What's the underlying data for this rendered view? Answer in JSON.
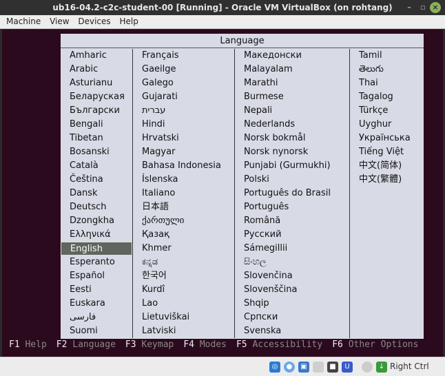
{
  "window": {
    "title": "ub16-04.2-c2c-student-00 [Running] - Oracle VM VirtualBox (on rohtang)"
  },
  "menu": [
    "Machine",
    "View",
    "Devices",
    "Help"
  ],
  "dialog": {
    "title": "Language",
    "selected": "English",
    "columns": [
      [
        "Amharic",
        "Arabic",
        "Asturianu",
        "Беларуская",
        "Български",
        "Bengali",
        "Tibetan",
        "Bosanski",
        "Català",
        "Čeština",
        "Dansk",
        "Deutsch",
        "Dzongkha",
        "Ελληνικά",
        "English",
        "Esperanto",
        "Español",
        "Eesti",
        "Euskara",
        "فارسی",
        "Suomi"
      ],
      [
        "Français",
        "Gaeilge",
        "Galego",
        "Gujarati",
        "עברית",
        "Hindi",
        "Hrvatski",
        "Magyar",
        "Bahasa Indonesia",
        "Íslenska",
        "Italiano",
        "日本語",
        "ქართული",
        "Қазақ",
        "Khmer",
        "ಕನ್ನಡ",
        "한국어",
        "Kurdî",
        "Lao",
        "Lietuviškai",
        "Latviski"
      ],
      [
        "Македонски",
        "Malayalam",
        "Marathi",
        "Burmese",
        "Nepali",
        "Nederlands",
        "Norsk bokmål",
        "Norsk nynorsk",
        "Punjabi (Gurmukhi)",
        "Polski",
        "Português do Brasil",
        "Português",
        "Română",
        "Русский",
        "Sámegillii",
        "සිංහල",
        "Slovenčina",
        "Slovenščina",
        "Shqip",
        "Српски",
        "Svenska"
      ],
      [
        "Tamil",
        "తెలుగు",
        "Thai",
        "Tagalog",
        "Türkçe",
        "Uyghur",
        "Українська",
        "Tiếng Việt",
        "中文(简体)",
        "中文(繁體)"
      ]
    ]
  },
  "fkeys": [
    {
      "key": "F1",
      "label": "Help"
    },
    {
      "key": "F2",
      "label": "Language"
    },
    {
      "key": "F3",
      "label": "Keymap"
    },
    {
      "key": "F4",
      "label": "Modes"
    },
    {
      "key": "F5",
      "label": "Accessibility"
    },
    {
      "key": "F6",
      "label": "Other Options"
    }
  ],
  "status": {
    "host_key": "Right Ctrl"
  }
}
